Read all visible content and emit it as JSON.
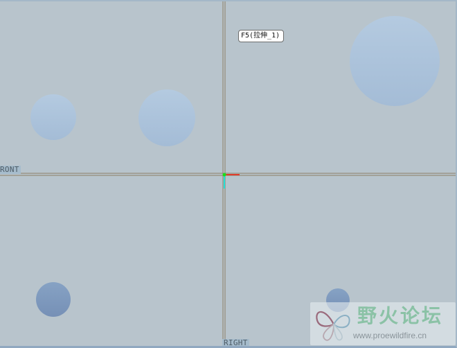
{
  "viewport": {
    "background": "#b8c4cc",
    "datum_planes": {
      "front_label": "RONT",
      "right_label": "RIGHT"
    },
    "tooltip": {
      "text": "F5(拉伸_1)"
    },
    "sketch_circles": {
      "light_fill": "#a8c0d8",
      "dark_fill": "#7c98bc",
      "count": 6
    },
    "coordinate_axes": {
      "x_color": "#e03a2a",
      "y_color": "#24e0d8",
      "origin_color": "#18e018"
    }
  },
  "watermark": {
    "logo": "butterfly-logo-icon",
    "title": "野火论坛",
    "url": "www.proewildfire.cn"
  }
}
